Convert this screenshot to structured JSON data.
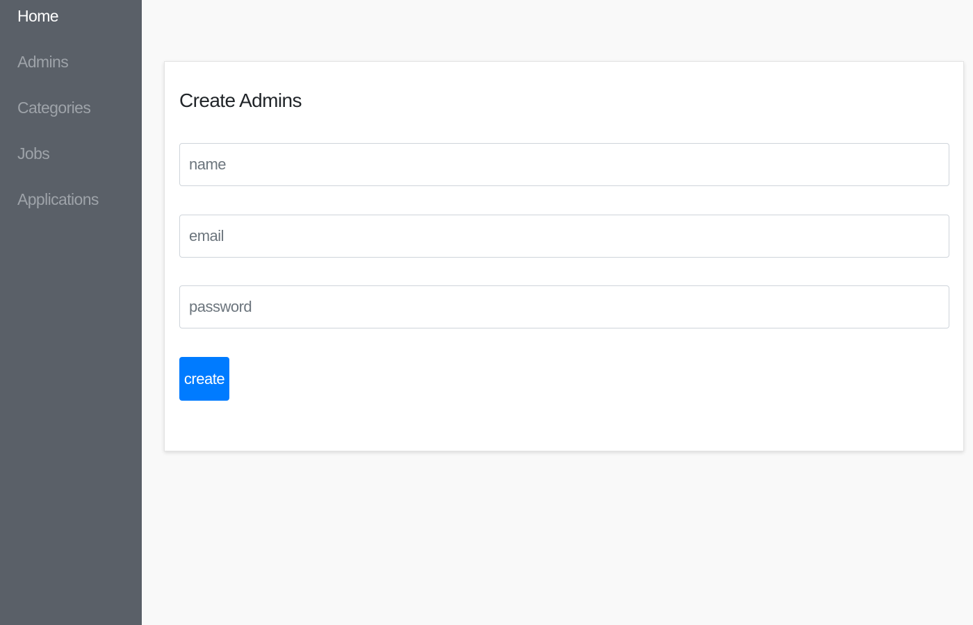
{
  "sidebar": {
    "items": [
      {
        "label": "Home",
        "active": true
      },
      {
        "label": "Admins",
        "active": false
      },
      {
        "label": "Categories",
        "active": false
      },
      {
        "label": "Jobs",
        "active": false
      },
      {
        "label": "Applications",
        "active": false
      }
    ]
  },
  "form": {
    "title": "Create Admins",
    "name_placeholder": "name",
    "email_placeholder": "email",
    "password_placeholder": "password",
    "submit_label": "create"
  },
  "colors": {
    "sidebar_bg": "#5a6068",
    "sidebar_text": "#9ea3a9",
    "sidebar_active_text": "#ffffff",
    "page_bg": "#f9f9f9",
    "primary_button": "#007bff"
  }
}
